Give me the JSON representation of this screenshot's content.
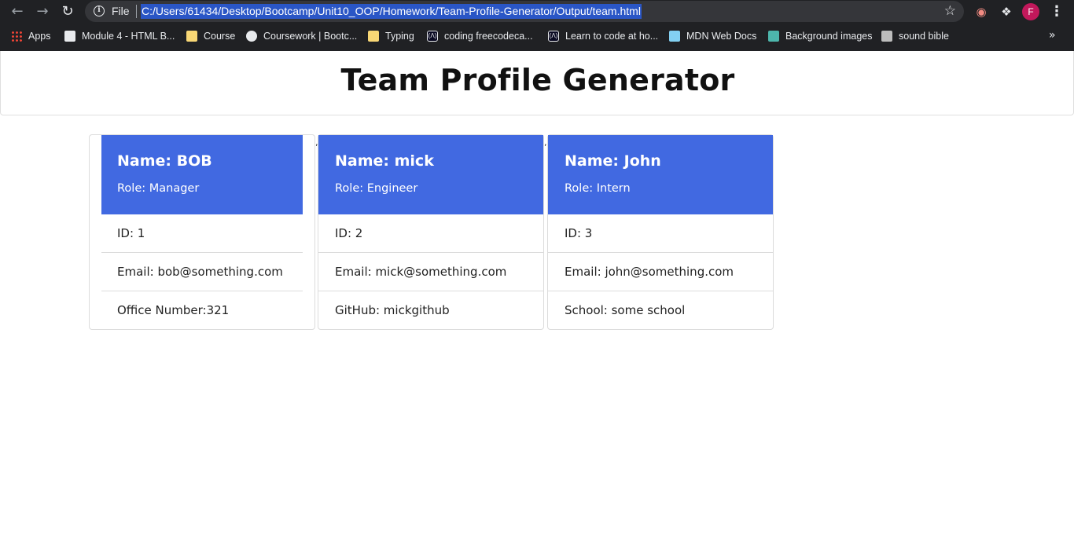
{
  "browser": {
    "file_label": "File",
    "url": "C:/Users/61434/Desktop/Bootcamp/Unit10_OOP/Homework/Team-Profile-Generator/Output/team.html",
    "avatar_letter": "F",
    "bookmarks": [
      {
        "label": "Apps",
        "icon": "apps-grid-icon"
      },
      {
        "label": "Module 4 - HTML B...",
        "icon": "book-icon"
      },
      {
        "label": "Course",
        "icon": "folder-icon"
      },
      {
        "label": "Coursework | Bootc...",
        "icon": "globe-icon"
      },
      {
        "label": "Typing",
        "icon": "folder-icon"
      },
      {
        "label": "coding freecodeca...",
        "icon": "freecodecamp-icon"
      },
      {
        "label": "Learn to code at ho...",
        "icon": "freecodecamp-icon"
      },
      {
        "label": "MDN Web Docs",
        "icon": "mdn-icon"
      },
      {
        "label": "Background images",
        "icon": "background-images-icon"
      },
      {
        "label": "sound bible",
        "icon": "sound-bible-icon"
      }
    ]
  },
  "page": {
    "title": "Team Profile Generator"
  },
  "separator": ",",
  "colors": {
    "card_header": "#4169e1",
    "chrome_bg": "#202124",
    "url_highlight": "#2a56c6"
  },
  "cards": [
    {
      "name": "Name: BOB",
      "role": "Role: Manager",
      "id": "ID: 1",
      "email": "Email: bob@something.com",
      "extra": "Office Number:321"
    },
    {
      "name": "Name: mick",
      "role": "Role: Engineer",
      "id": "ID: 2",
      "email": "Email: mick@something.com",
      "extra": "GitHub: mickgithub"
    },
    {
      "name": "Name: John",
      "role": "Role: Intern",
      "id": "ID: 3",
      "email": "Email: john@something.com",
      "extra": "School: some school"
    }
  ]
}
